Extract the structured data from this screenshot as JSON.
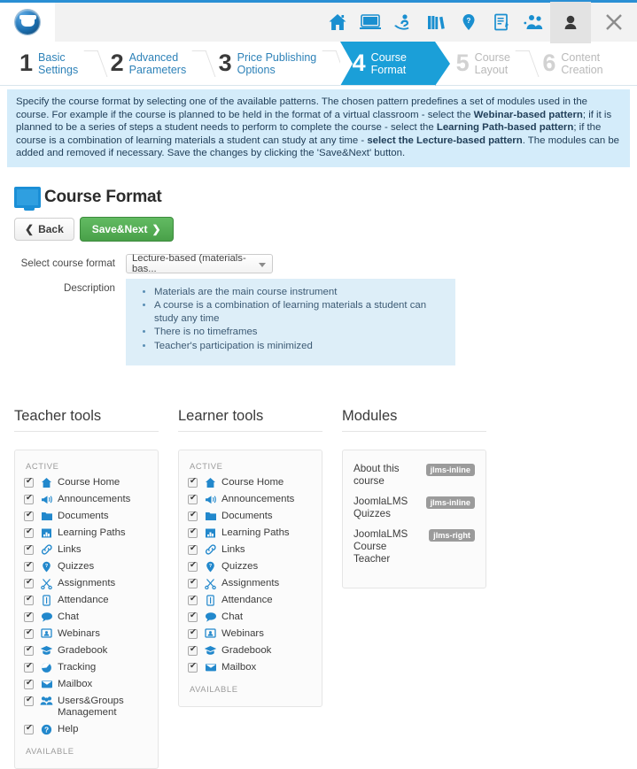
{
  "topbar": {
    "logo_name": "joomlalms-logo",
    "icons": [
      {
        "name": "home-icon",
        "title": "Home"
      },
      {
        "name": "classroom-icon",
        "title": "Classroom"
      },
      {
        "name": "learning-icon",
        "title": "Learning"
      },
      {
        "name": "library-icon",
        "title": "Library"
      },
      {
        "name": "quiz-pin-icon",
        "title": "Quizzes"
      },
      {
        "name": "report-icon",
        "title": "Reports"
      },
      {
        "name": "users-icon",
        "title": "Users"
      },
      {
        "name": "avatar-icon",
        "title": "Account"
      },
      {
        "name": "close-icon",
        "title": "Close"
      }
    ]
  },
  "steps": [
    {
      "num": "1",
      "line1": "Basic",
      "line2": "Settings",
      "state": "done"
    },
    {
      "num": "2",
      "line1": "Advanced",
      "line2": "Parameters",
      "state": "done"
    },
    {
      "num": "3",
      "line1": "Price Publishing",
      "line2": "Options",
      "state": "done"
    },
    {
      "num": "4",
      "line1": "Course",
      "line2": "Format",
      "state": "active"
    },
    {
      "num": "5",
      "line1": "Course",
      "line2": "Layout",
      "state": "future"
    },
    {
      "num": "6",
      "line1": "Content",
      "line2": "Creation",
      "state": "future"
    }
  ],
  "notice": {
    "p1": "Specify the course format by selecting one of the available patterns. The chosen pattern predefines a set of modules used in the course. For example if the course is planned to be held in the format of a virtual classroom - select the ",
    "b1": "Webinar-based pattern",
    "p2": "; if it is planned to be a series of steps a student needs to perform to complete the course - select the ",
    "b2": "Learning Path-based pattern",
    "p3": "; if the course is a combination of learning materials a student can study at any time - ",
    "b3": "select the Lecture-based pattern",
    "p4": ". The modules can be added and removed if necessary. Save the changes by clicking the 'Save&Next' button."
  },
  "page": {
    "title": "Course Format",
    "back_label": "Back",
    "next_label": "Save&Next"
  },
  "form": {
    "select_label": "Select course format",
    "select_value": "Lecture-based (materials-bas...",
    "description_label": "Description",
    "description_items": [
      "Materials are the main course instrument",
      "A course is a combination of learning materials a student can study any time",
      "There is no timeframes",
      "Teacher's participation is minimized"
    ]
  },
  "columns": {
    "teacher": {
      "title": "Teacher tools",
      "active_header": "ACTIVE",
      "available_header": "AVAILABLE",
      "tools": [
        {
          "label": "Course Home",
          "icon": "home-tool-icon",
          "checked": true
        },
        {
          "label": "Announcements",
          "icon": "megaphone-icon",
          "checked": true
        },
        {
          "label": "Documents",
          "icon": "folder-icon",
          "checked": true
        },
        {
          "label": "Learning Paths",
          "icon": "path-icon",
          "checked": true
        },
        {
          "label": "Links",
          "icon": "link-icon",
          "checked": true
        },
        {
          "label": "Quizzes",
          "icon": "quiz-pin-icon",
          "checked": true
        },
        {
          "label": "Assignments",
          "icon": "scissors-icon",
          "checked": true
        },
        {
          "label": "Attendance",
          "icon": "attendance-icon",
          "checked": true
        },
        {
          "label": "Chat",
          "icon": "chat-icon",
          "checked": true
        },
        {
          "label": "Webinars",
          "icon": "webinar-icon",
          "checked": true
        },
        {
          "label": "Gradebook",
          "icon": "graduation-cap-icon",
          "checked": true
        },
        {
          "label": "Tracking",
          "icon": "pie-chart-icon",
          "checked": true
        },
        {
          "label": "Mailbox",
          "icon": "mail-icon",
          "checked": true
        },
        {
          "label": "Users&Groups Management",
          "icon": "people-icon",
          "checked": true
        },
        {
          "label": "Help",
          "icon": "help-icon",
          "checked": true
        }
      ]
    },
    "learner": {
      "title": "Learner tools",
      "active_header": "ACTIVE",
      "available_header": "AVAILABLE",
      "tools": [
        {
          "label": "Course Home",
          "icon": "home-tool-icon",
          "checked": true
        },
        {
          "label": "Announcements",
          "icon": "megaphone-icon",
          "checked": true
        },
        {
          "label": "Documents",
          "icon": "folder-icon",
          "checked": true
        },
        {
          "label": "Learning Paths",
          "icon": "path-icon",
          "checked": true
        },
        {
          "label": "Links",
          "icon": "link-icon",
          "checked": true
        },
        {
          "label": "Quizzes",
          "icon": "quiz-pin-icon",
          "checked": true
        },
        {
          "label": "Assignments",
          "icon": "scissors-icon",
          "checked": true
        },
        {
          "label": "Attendance",
          "icon": "attendance-icon",
          "checked": true
        },
        {
          "label": "Chat",
          "icon": "chat-icon",
          "checked": true
        },
        {
          "label": "Webinars",
          "icon": "webinar-icon",
          "checked": true
        },
        {
          "label": "Gradebook",
          "icon": "graduation-cap-icon",
          "checked": true
        },
        {
          "label": "Mailbox",
          "icon": "mail-icon",
          "checked": true
        }
      ]
    },
    "modules": {
      "title": "Modules",
      "items": [
        {
          "name": "About this course",
          "badge": "jlms-inline"
        },
        {
          "name": "JoomlaLMS Quizzes",
          "badge": "jlms-inline"
        },
        {
          "name": "JoomlaLMS Course Teacher",
          "badge": "jlms-right"
        }
      ]
    }
  },
  "colors": {
    "accent_blue": "#1b9fd8",
    "notice_bg": "#d4ecfa",
    "desc_bg": "#ddeef8",
    "save_green": "#49a049",
    "badge_gray": "#9b9b9b"
  }
}
